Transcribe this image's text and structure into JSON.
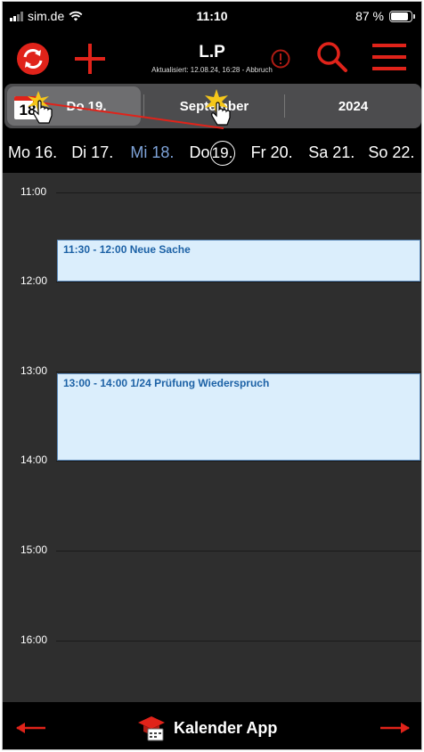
{
  "status": {
    "carrier": "sim.de",
    "time": "11:10",
    "battery": "87 %"
  },
  "toolbar": {
    "title": "L.P",
    "subtitle": "Aktualisiert: 12.08.24, 16:28 - Abbruch",
    "icons": [
      "sync-icon",
      "plus-icon",
      "alert-icon",
      "search-icon",
      "menu-icon"
    ],
    "accent": "#e0231a"
  },
  "segments": {
    "calendar_day": "18",
    "day": "Do 19.",
    "month": "September",
    "year": "2024"
  },
  "week": [
    "Mo 16.",
    "Di 17.",
    "Mi 18.",
    "Do",
    "19.",
    "Fr 20.",
    "Sa 21.",
    "So 22."
  ],
  "hours": [
    "11:00",
    "12:00",
    "13:00",
    "14:00",
    "15:00",
    "16:00"
  ],
  "events": [
    {
      "text": "11:30 - 12:00 Neue Sache"
    },
    {
      "text": "13:00 - 14:00 1/24 Prüfung Wiederspruch"
    }
  ],
  "bottom": {
    "app_name": "Kalender App"
  }
}
